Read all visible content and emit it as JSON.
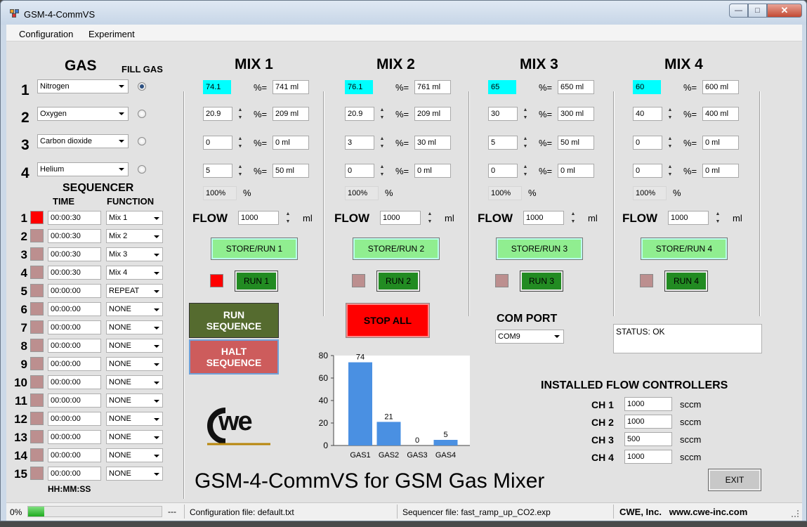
{
  "window": {
    "title": "GSM-4-CommVS",
    "min": "—",
    "max": "□",
    "close": "✕"
  },
  "menu": [
    "Configuration",
    "Experiment"
  ],
  "gas": {
    "header": "GAS",
    "fill_header": "FILL GAS",
    "rows": [
      {
        "num": "1",
        "name": "Nitrogen",
        "fill": true
      },
      {
        "num": "2",
        "name": "Oxygen",
        "fill": false
      },
      {
        "num": "3",
        "name": "Carbon dioxide",
        "fill": false
      },
      {
        "num": "4",
        "name": "Helium",
        "fill": false
      }
    ]
  },
  "mixes": [
    {
      "title": "MIX 1",
      "values": [
        "74.1",
        "20.9",
        "0",
        "5"
      ],
      "mls": [
        "741 ml",
        "209 ml",
        "0 ml",
        "50 ml"
      ],
      "total": "100%",
      "flow": "1000",
      "store": "STORE/RUN 1",
      "run": "RUN 1",
      "active": true
    },
    {
      "title": "MIX 2",
      "values": [
        "76.1",
        "20.9",
        "3",
        "0"
      ],
      "mls": [
        "761 ml",
        "209 ml",
        "30 ml",
        "0 ml"
      ],
      "total": "100%",
      "flow": "1000",
      "store": "STORE/RUN 2",
      "run": "RUN 2",
      "active": false
    },
    {
      "title": "MIX 3",
      "values": [
        "65",
        "30",
        "5",
        "0"
      ],
      "mls": [
        "650 ml",
        "300 ml",
        "50 ml",
        "0 ml"
      ],
      "total": "100%",
      "flow": "1000",
      "store": "STORE/RUN 3",
      "run": "RUN 3",
      "active": false
    },
    {
      "title": "MIX 4",
      "values": [
        "60",
        "40",
        "0",
        "0"
      ],
      "mls": [
        "600 ml",
        "400 ml",
        "0 ml",
        "0 ml"
      ],
      "total": "100%",
      "flow": "1000",
      "store": "STORE/RUN 4",
      "run": "RUN 4",
      "active": false
    }
  ],
  "labels": {
    "pct_eq": "%=",
    "pct": "%",
    "flow": "FLOW",
    "ml": "ml"
  },
  "sequencer": {
    "title": "SEQUENCER",
    "time_header": "TIME",
    "func_header": "FUNCTION",
    "footer": "HH:MM:SS",
    "rows": [
      {
        "num": "1",
        "time": "00:00:30",
        "func": "Mix 1",
        "active": true
      },
      {
        "num": "2",
        "time": "00:00:30",
        "func": "Mix 2",
        "active": false
      },
      {
        "num": "3",
        "time": "00:00:30",
        "func": "Mix 3",
        "active": false
      },
      {
        "num": "4",
        "time": "00:00:30",
        "func": "Mix 4",
        "active": false
      },
      {
        "num": "5",
        "time": "00:00:00",
        "func": "REPEAT",
        "active": false
      },
      {
        "num": "6",
        "time": "00:00:00",
        "func": "NONE",
        "active": false
      },
      {
        "num": "7",
        "time": "00:00:00",
        "func": "NONE",
        "active": false
      },
      {
        "num": "8",
        "time": "00:00:00",
        "func": "NONE",
        "active": false
      },
      {
        "num": "9",
        "time": "00:00:00",
        "func": "NONE",
        "active": false
      },
      {
        "num": "10",
        "time": "00:00:00",
        "func": "NONE",
        "active": false
      },
      {
        "num": "11",
        "time": "00:00:00",
        "func": "NONE",
        "active": false
      },
      {
        "num": "12",
        "time": "00:00:00",
        "func": "NONE",
        "active": false
      },
      {
        "num": "13",
        "time": "00:00:00",
        "func": "NONE",
        "active": false
      },
      {
        "num": "14",
        "time": "00:00:00",
        "func": "NONE",
        "active": false
      },
      {
        "num": "15",
        "time": "00:00:00",
        "func": "NONE",
        "active": false
      }
    ]
  },
  "buttons": {
    "run_sequence": "RUN\nSEQUENCE",
    "halt_sequence": "HALT\nSEQUENCE",
    "stop_all": "STOP ALL",
    "exit": "EXIT"
  },
  "com": {
    "label": "COM PORT",
    "value": "COM9"
  },
  "status_box": "STATUS: OK",
  "logo_text": "we",
  "app_heading": "GSM-4-CommVS for GSM Gas Mixer",
  "controllers": {
    "title": "INSTALLED FLOW CONTROLLERS",
    "unit": "sccm",
    "rows": [
      {
        "ch": "CH 1",
        "value": "1000"
      },
      {
        "ch": "CH 2",
        "value": "1000"
      },
      {
        "ch": "CH 3",
        "value": "500"
      },
      {
        "ch": "CH 4",
        "value": "1000"
      }
    ]
  },
  "statusbar": {
    "progress_label": "0%",
    "progress": 0.12,
    "dashes": "---",
    "config": "Configuration file:  default.txt",
    "sequencer": "Sequencer file:  fast_ramp_up_CO2.exp",
    "company": "CWE, Inc.   www.cwe-inc.com"
  },
  "colors": {
    "bar": "#4a90e2",
    "run_seq": "#556b2f",
    "halt_seq": "#cd5c5c",
    "stop_all": "#ff0000"
  },
  "chart_data": {
    "type": "bar",
    "categories": [
      "GAS1",
      "GAS2",
      "GAS3",
      "GAS4"
    ],
    "values": [
      74,
      21,
      0,
      5
    ],
    "data_labels": [
      "74",
      "21",
      "0",
      "5"
    ],
    "ylim": [
      0,
      80
    ],
    "yticks": [
      0,
      20,
      40,
      60,
      80
    ],
    "title": "",
    "xlabel": "",
    "ylabel": ""
  }
}
